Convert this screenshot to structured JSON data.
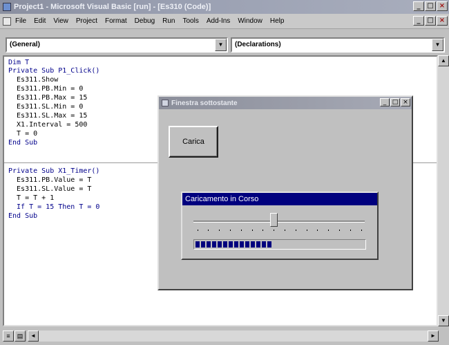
{
  "window": {
    "title": "Project1 - Microsoft Visual Basic [run] - [Es310 (Code)]",
    "buttons": [
      "_",
      "□",
      "×"
    ]
  },
  "menu": {
    "items": [
      "File",
      "Edit",
      "View",
      "Project",
      "Format",
      "Debug",
      "Run",
      "Tools",
      "Add-Ins",
      "Window",
      "Help"
    ]
  },
  "combos": {
    "object": "(General)",
    "procedure": "(Declarations)",
    "arrow": "▼"
  },
  "code": {
    "lines": [
      "Dim T",
      "Private Sub P1_Click()",
      "  Es311.Show",
      "  Es311.PB.Min = 0",
      "  Es311.PB.Max = 15",
      "  Es311.SL.Min = 0",
      "  Es311.SL.Max = 15",
      "  X1.Interval = 500",
      "  T = 0",
      "End Sub",
      "",
      "Private Sub X1_Timer()",
      "  Es311.PB.Value = T",
      "  Es311.SL.Value = T",
      "  T = T + 1",
      "  If T = 15 Then T = 0",
      "End Sub"
    ]
  },
  "form1": {
    "title": "Finestra sottostante",
    "button_label": "Carica",
    "buttons": [
      "_",
      "□",
      "×"
    ]
  },
  "form2": {
    "title": "Caricamento in Corso",
    "slider": {
      "min": 0,
      "max": 15,
      "value": 7
    },
    "progress": {
      "min": 0,
      "max": 15,
      "value": 7
    }
  },
  "scroll": {
    "up": "▲",
    "down": "▼",
    "left": "◄",
    "right": "►"
  }
}
